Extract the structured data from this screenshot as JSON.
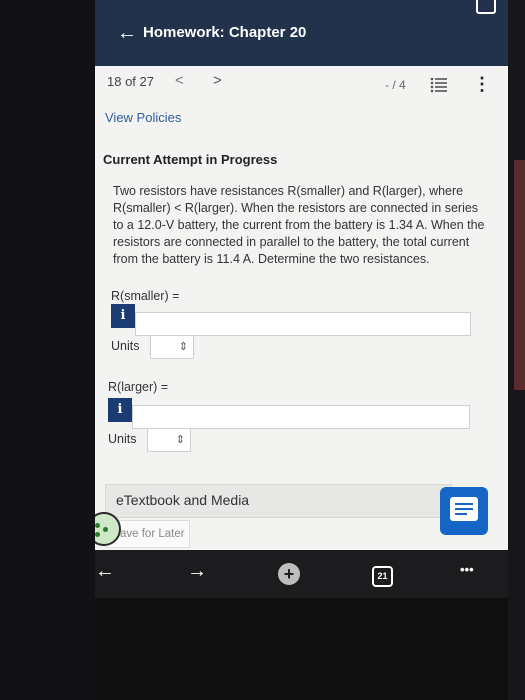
{
  "header": {
    "title": "Homework: Chapter 20",
    "back_glyph": "←"
  },
  "nav": {
    "position": "18 of 27",
    "prev_glyph": "<",
    "next_glyph": ">",
    "score": "- / 4",
    "more_glyph": "⋮"
  },
  "view_policies": "View Policies",
  "attempt_status": "Current Attempt in Progress",
  "question": "Two resistors have resistances R(smaller) and R(larger), where R(smaller) < R(larger). When the resistors are connected in series to a 12.0-V battery, the current from the battery is 1.34 A. When the resistors are connected in parallel to the battery, the total current from the battery is 11.4 A. Determine the two resistances.",
  "answers": [
    {
      "label": "R(smaller) =",
      "info": "i",
      "units_label": "Units",
      "units_value": ""
    },
    {
      "label": "R(larger) =",
      "info": "i",
      "units_label": "Units",
      "units_value": ""
    }
  ],
  "etextbook": "eTextbook and Media",
  "save_later": "ave for Later",
  "bottom_nav": {
    "back": "←",
    "forward": "→",
    "new_tab": "+",
    "tab_count": "21",
    "more": "•••"
  },
  "colors": {
    "header_bg": "#22324a",
    "link": "#2f5c9c",
    "info_button": "#1b3c73",
    "chat_button": "#1566c7"
  }
}
